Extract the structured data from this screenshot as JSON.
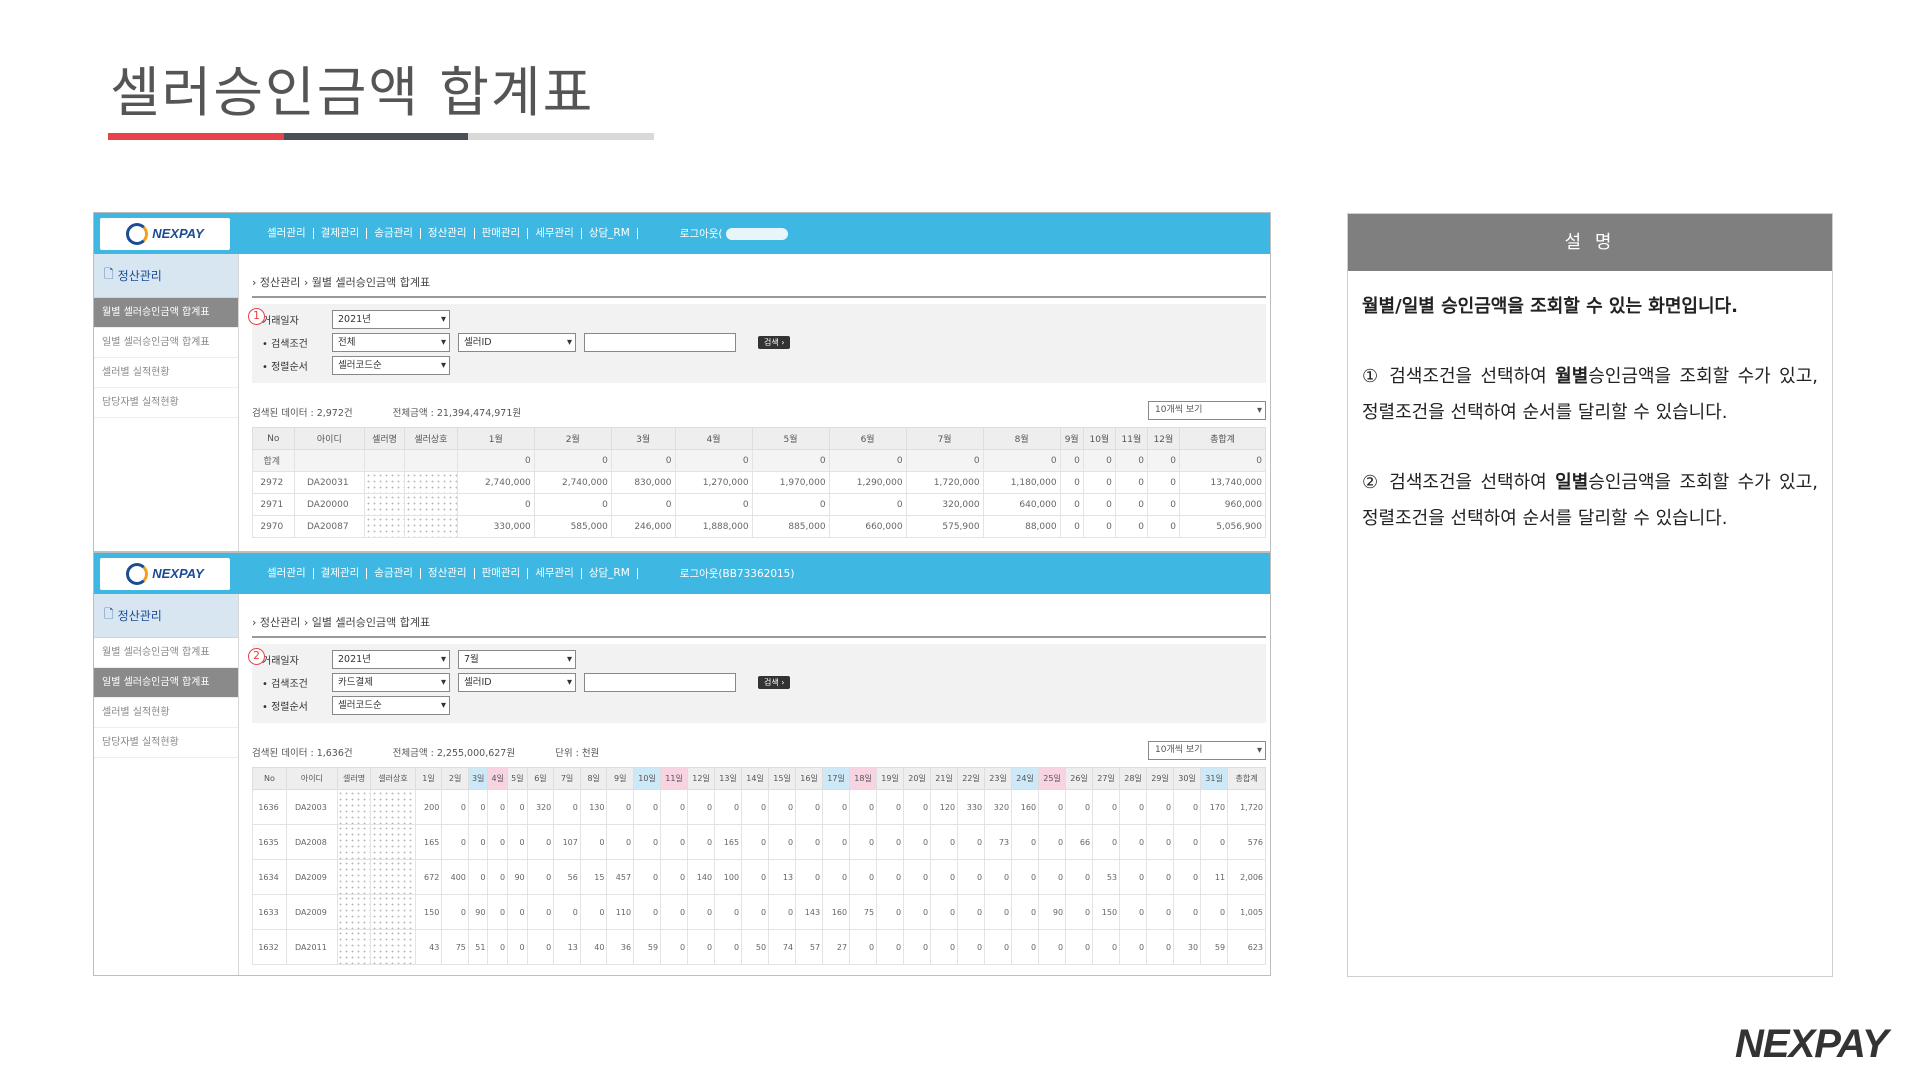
{
  "title": "셀러승인금액 합계표",
  "brand": "NEXPAY",
  "logo_text": "NEXPAY",
  "nav": {
    "items": [
      "셀러관리",
      "결제관리",
      "송금관리",
      "정산관리",
      "판매관리",
      "세무관리",
      "상담_RM"
    ],
    "logout1": "로그아웃(",
    "logout2": "로그아웃(BB73362015)"
  },
  "sidebar": {
    "head": "정산관리",
    "items": [
      "월별 셀러승인금액 합계표",
      "일별 셀러승인금액 합계표",
      "셀러별 실적현황",
      "담당자별 실적현황"
    ]
  },
  "screen1": {
    "breadcrumb": "› 정산관리 › 월별 셀러승인금액 합계표",
    "marker": "1",
    "labels": [
      "거래일자",
      "• 검색조건",
      "• 정렬순서"
    ],
    "year": "2021년",
    "cond": "전체",
    "field": "셀러ID",
    "sort": "셀러코드순",
    "search_btn": "검색 ›",
    "count": "검색된 데이터 : 2,972건",
    "total": "전체금액 : 21,394,474,971원",
    "view": "10개씩 보기",
    "headers": [
      "No",
      "아이디",
      "셀러명",
      "셀러상호",
      "1월",
      "2월",
      "3월",
      "4월",
      "5월",
      "6월",
      "7월",
      "8월",
      "9월",
      "10월",
      "11월",
      "12월",
      "총합계"
    ],
    "sum_label": "합계",
    "sum_row": [
      "0",
      "0",
      "0",
      "0",
      "0",
      "0",
      "0",
      "0",
      "0",
      "0",
      "0",
      "0",
      "0"
    ],
    "rows": [
      {
        "no": "2972",
        "id": "DA20031",
        "vals": [
          "2,740,000",
          "2,740,000",
          "830,000",
          "1,270,000",
          "1,970,000",
          "1,290,000",
          "1,720,000",
          "1,180,000",
          "0",
          "0",
          "0",
          "0",
          "13,740,000"
        ]
      },
      {
        "no": "2971",
        "id": "DA20000",
        "vals": [
          "0",
          "0",
          "0",
          "0",
          "0",
          "0",
          "320,000",
          "640,000",
          "0",
          "0",
          "0",
          "0",
          "960,000"
        ]
      },
      {
        "no": "2970",
        "id": "DA20087",
        "vals": [
          "330,000",
          "585,000",
          "246,000",
          "1,888,000",
          "885,000",
          "660,000",
          "575,900",
          "88,000",
          "0",
          "0",
          "0",
          "0",
          "5,056,900"
        ]
      }
    ]
  },
  "screen2": {
    "breadcrumb": "› 정산관리 › 일별 셀러승인금액 합계표",
    "marker": "2",
    "labels": [
      "거래일자",
      "• 검색조건",
      "• 정렬순서"
    ],
    "year": "2021년",
    "month": "7월",
    "cond": "카드결제",
    "field": "셀러ID",
    "sort": "셀러코드순",
    "search_btn": "검색 ›",
    "count": "검색된 데이터 : 1,636건",
    "total": "전체금액 : 2,255,000,627원",
    "unit": "단위 : 천원",
    "view": "10개씩 보기",
    "headers": [
      "No",
      "아이디",
      "셀러명",
      "셀러상호",
      "1일",
      "2일",
      "3일",
      "4일",
      "5일",
      "6일",
      "7일",
      "8일",
      "9일",
      "10일",
      "11일",
      "12일",
      "13일",
      "14일",
      "15일",
      "16일",
      "17일",
      "18일",
      "19일",
      "20일",
      "21일",
      "22일",
      "23일",
      "24일",
      "25일",
      "26일",
      "27일",
      "28일",
      "29일",
      "30일",
      "31일",
      "총합계"
    ],
    "rows": [
      {
        "no": "1636",
        "id": "DA2003",
        "vals": [
          "200",
          "0",
          "0",
          "0",
          "0",
          "320",
          "0",
          "130",
          "0",
          "0",
          "0",
          "0",
          "0",
          "0",
          "0",
          "0",
          "0",
          "0",
          "0",
          "0",
          "120",
          "330",
          "320",
          "160",
          "0",
          "0",
          "0",
          "0",
          "0",
          "0",
          "170",
          "1,720"
        ]
      },
      {
        "no": "1635",
        "id": "DA2008",
        "vals": [
          "165",
          "0",
          "0",
          "0",
          "0",
          "0",
          "107",
          "0",
          "0",
          "0",
          "0",
          "0",
          "165",
          "0",
          "0",
          "0",
          "0",
          "0",
          "0",
          "0",
          "0",
          "0",
          "73",
          "0",
          "0",
          "66",
          "0",
          "0",
          "0",
          "0",
          "0",
          "576"
        ]
      },
      {
        "no": "1634",
        "id": "DA2009",
        "vals": [
          "672",
          "400",
          "0",
          "0",
          "90",
          "0",
          "56",
          "15",
          "457",
          "0",
          "0",
          "140",
          "100",
          "0",
          "13",
          "0",
          "0",
          "0",
          "0",
          "0",
          "0",
          "0",
          "0",
          "0",
          "0",
          "0",
          "53",
          "0",
          "0",
          "0",
          "11",
          "2,006"
        ]
      },
      {
        "no": "1633",
        "id": "DA2009",
        "vals": [
          "150",
          "0",
          "90",
          "0",
          "0",
          "0",
          "0",
          "0",
          "110",
          "0",
          "0",
          "0",
          "0",
          "0",
          "0",
          "143",
          "160",
          "75",
          "0",
          "0",
          "0",
          "0",
          "0",
          "0",
          "90",
          "0",
          "150",
          "0",
          "0",
          "0",
          "0",
          "1,005"
        ]
      },
      {
        "no": "1632",
        "id": "DA2011",
        "vals": [
          "43",
          "75",
          "51",
          "0",
          "0",
          "0",
          "13",
          "40",
          "36",
          "59",
          "0",
          "0",
          "0",
          "50",
          "74",
          "57",
          "27",
          "0",
          "0",
          "0",
          "0",
          "0",
          "0",
          "0",
          "0",
          "0",
          "0",
          "0",
          "0",
          "30",
          "59",
          "623"
        ]
      }
    ]
  },
  "panel": {
    "head": "설 명",
    "lead": "월별/일별 승인금액을 조회할 수 있는 화면입니다.",
    "p1_pre": "① 검색조건을 선택하여 ",
    "p1_bold": "월별",
    "p1_post": "승인금액을 조회할 수가 있고, 정렬조건을 선택하여 순서를 달리할 수 있습니다.",
    "p2_pre": "② 검색조건을 선택하여 ",
    "p2_bold": "일별",
    "p2_post": "승인금액을 조회할 수가 있고, 정렬조건을 선택하여 순서를 달리할 수 있습니다."
  },
  "colors": {
    "accent_red": "#e8434b",
    "nav_blue": "#3eb8e3",
    "dark": "#4a4e57"
  }
}
